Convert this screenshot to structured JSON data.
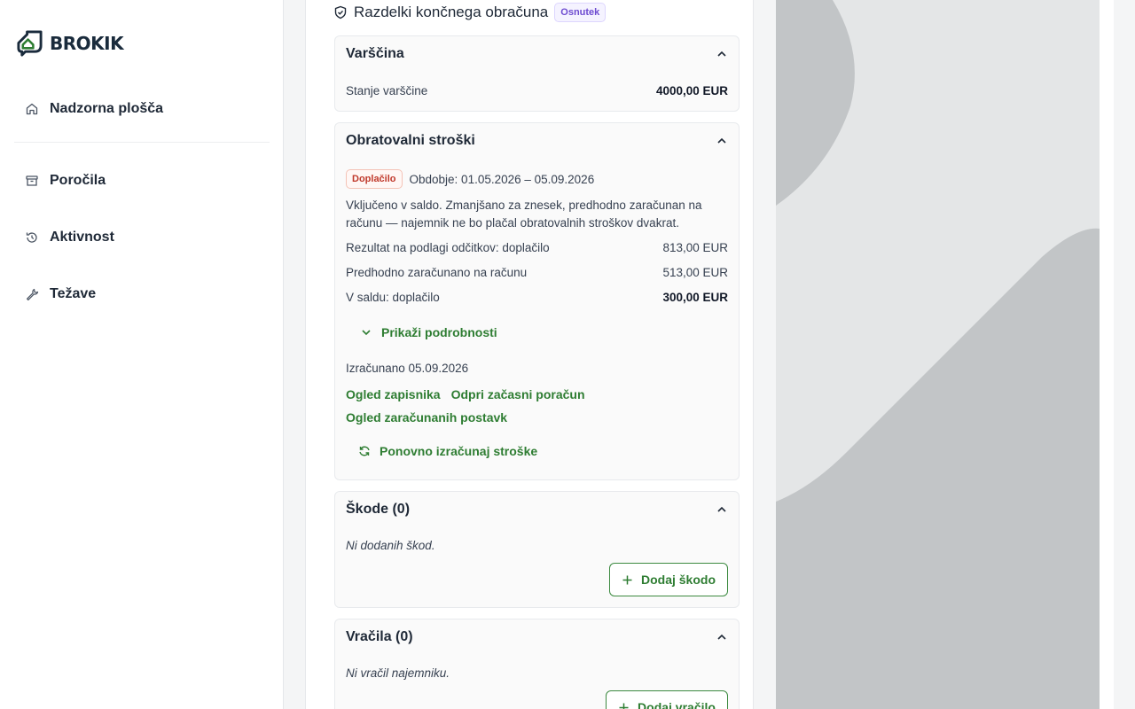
{
  "sidebar": {
    "logo_text": "BROKIK",
    "items": [
      {
        "label": "Nadzorna plošča",
        "icon": "home-icon"
      },
      {
        "label": "Poročila",
        "icon": "archive-icon"
      },
      {
        "label": "Aktivnost",
        "icon": "history-icon"
      },
      {
        "label": "Težave",
        "icon": "wrench-icon"
      }
    ]
  },
  "main": {
    "title": "Razdelki končnega obračuna",
    "status_badge": "Osnutek",
    "deposit": {
      "heading": "Varščina",
      "balance_label": "Stanje varščine",
      "balance_value": "4000,00 EUR"
    },
    "operating_costs": {
      "heading": "Obratovalni stroški",
      "type_badge": "Doplačilo",
      "period": "Obdobje: 01.05.2026 – 05.09.2026",
      "note": "Vključeno v saldo. Zmanjšano za znesek, predhodno zaračunan na računu — najemnik ne bo plačal obratovalnih stroškov dvakrat.",
      "rows": [
        {
          "label": "Rezultat na podlagi odčitkov: doplačilo",
          "value": "813,00 EUR"
        },
        {
          "label": "Predhodno zaračunano na računu",
          "value": "513,00 EUR"
        },
        {
          "label": "V saldu: doplačilo",
          "value": "300,00 EUR"
        }
      ],
      "show_details": "Prikaži podrobnosti",
      "calculated": "Izračunano 05.09.2026",
      "link_minutes": "Ogled zapisnika",
      "link_temp_invoice": "Odpri začasni poračun",
      "link_charged_items": "Ogled zaračunanih postavk",
      "recalculate": "Ponovno izračunaj stroške"
    },
    "damages": {
      "heading": "Škode (0)",
      "empty": "Ni dodanih škod.",
      "add_button": "Dodaj škodo"
    },
    "refunds": {
      "heading": "Vračila (0)",
      "empty": "Ni vračil najemniku.",
      "add_button": "Dodaj vračilo"
    }
  },
  "colors": {
    "accent_green": "#2e7d32",
    "draft_purple": "#6d4bd0",
    "surcharge_red": "#c0392b"
  }
}
